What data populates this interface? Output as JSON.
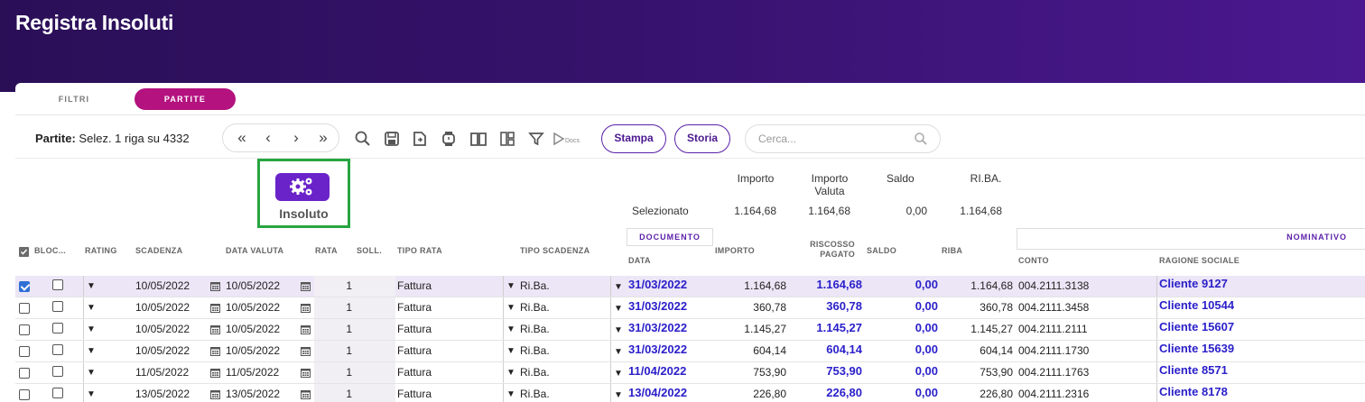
{
  "page": {
    "title": "Registra Insoluti"
  },
  "tabs": [
    {
      "label": "FILTRI",
      "active": false
    },
    {
      "label": "PARTITE",
      "active": true
    }
  ],
  "toolbar": {
    "partite_label": "Partite:",
    "selection_text": "Selez. 1 riga su 4332",
    "nav": {
      "first": "«",
      "prev": "‹",
      "next": "›",
      "last": "»"
    },
    "icons": [
      "search-icon",
      "save-icon",
      "export-icon",
      "watch-icon",
      "book-icon",
      "layout-icon",
      "filter-icon",
      "docs-icon"
    ],
    "docs_label": "Docs",
    "stampa_label": "Stampa",
    "storia_label": "Storia",
    "search_placeholder": "Cerca..."
  },
  "action": {
    "label": "Insoluto",
    "icon": "gears-icon"
  },
  "summary": {
    "headers": [
      "Importo",
      "Importo\nValuta",
      "Saldo",
      "RI.BA."
    ],
    "row_label": "Selezionato",
    "values": [
      "1.164,68",
      "1.164,68",
      "0,00",
      "1.164,68"
    ]
  },
  "groups": {
    "documento": "DOCUMENTO",
    "nominativo": "NOMINATIVO"
  },
  "columns": {
    "bloc": "BLOC...",
    "rating": "RATING",
    "scadenza": "SCADENZA",
    "data_valuta": "DATA VALUTA",
    "rata": "RATA",
    "soll": "SOLL.",
    "tipo_rata": "TIPO RATA",
    "tipo_scadenza": "TIPO SCADENZA",
    "data": "DATA",
    "importo": "IMPORTO",
    "riscosso_pagato": "RISCOSSO\nPAGATO",
    "saldo": "SALDO",
    "riba": "RIBA",
    "conto": "CONTO",
    "ragione_sociale": "RAGIONE SOCIALE"
  },
  "rows": [
    {
      "selected": true,
      "scadenza": "10/05/2022",
      "data_valuta": "10/05/2022",
      "rata": "1",
      "tipo_rata": "Fattura",
      "tipo_scadenza": "Ri.Ba.",
      "data": "31/03/2022",
      "importo": "1.164,68",
      "riscosso": "1.164,68",
      "saldo": "0,00",
      "riba": "1.164,68",
      "conto": "004.2111.3138",
      "ragione_sociale": "Cliente 9127"
    },
    {
      "selected": false,
      "scadenza": "10/05/2022",
      "data_valuta": "10/05/2022",
      "rata": "1",
      "tipo_rata": "Fattura",
      "tipo_scadenza": "Ri.Ba.",
      "data": "31/03/2022",
      "importo": "360,78",
      "riscosso": "360,78",
      "saldo": "0,00",
      "riba": "360,78",
      "conto": "004.2111.3458",
      "ragione_sociale": "Cliente 10544"
    },
    {
      "selected": false,
      "scadenza": "10/05/2022",
      "data_valuta": "10/05/2022",
      "rata": "1",
      "tipo_rata": "Fattura",
      "tipo_scadenza": "Ri.Ba.",
      "data": "31/03/2022",
      "importo": "1.145,27",
      "riscosso": "1.145,27",
      "saldo": "0,00",
      "riba": "1.145,27",
      "conto": "004.2111.2111",
      "ragione_sociale": "Cliente 15607"
    },
    {
      "selected": false,
      "scadenza": "10/05/2022",
      "data_valuta": "10/05/2022",
      "rata": "1",
      "tipo_rata": "Fattura",
      "tipo_scadenza": "Ri.Ba.",
      "data": "31/03/2022",
      "importo": "604,14",
      "riscosso": "604,14",
      "saldo": "0,00",
      "riba": "604,14",
      "conto": "004.2111.1730",
      "ragione_sociale": "Cliente 15639"
    },
    {
      "selected": false,
      "scadenza": "11/05/2022",
      "data_valuta": "11/05/2022",
      "rata": "1",
      "tipo_rata": "Fattura",
      "tipo_scadenza": "Ri.Ba.",
      "data": "11/04/2022",
      "importo": "753,90",
      "riscosso": "753,90",
      "saldo": "0,00",
      "riba": "753,90",
      "conto": "004.2111.1763",
      "ragione_sociale": "Cliente 8571"
    },
    {
      "selected": false,
      "scadenza": "13/05/2022",
      "data_valuta": "13/05/2022",
      "rata": "1",
      "tipo_rata": "Fattura",
      "tipo_scadenza": "Ri.Ba.",
      "data": "13/04/2022",
      "importo": "226,80",
      "riscosso": "226,80",
      "saldo": "0,00",
      "riba": "226,80",
      "conto": "004.2111.2316",
      "ragione_sociale": "Cliente 8178"
    }
  ]
}
